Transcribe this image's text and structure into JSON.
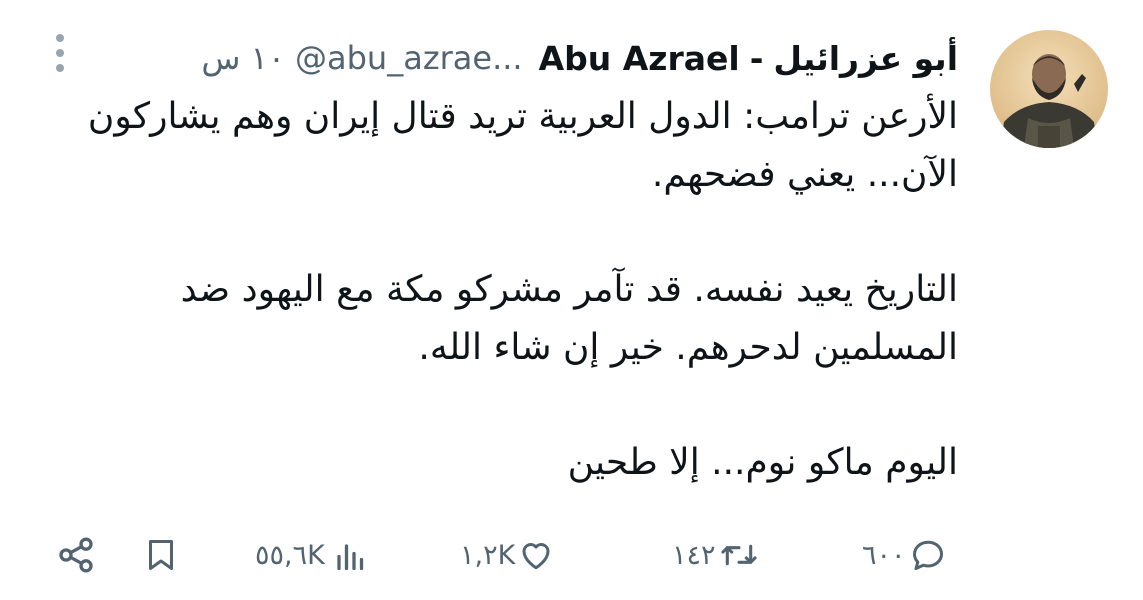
{
  "tweet": {
    "display_name_ar": "أبو عزرائيل",
    "separator": "-",
    "display_name_en": "Abu Azrael",
    "handle": "@abu_azrae...",
    "time": "١٠ س",
    "paragraphs": [
      "الأرعن ترامب: الدول العربية تريد قتال إيران وهم يشاركون الآن... يعني فضحهم.",
      "التاريخ يعيد نفسه. قد تآمر مشركو مكة مع اليهود ضد المسلمين لدحرهم. خير إن شاء الله.",
      "اليوم ماكو نوم... إلا طحين"
    ]
  },
  "actions": {
    "replies": "٦٠٠",
    "reposts": "١٤٢",
    "likes": "١,٢K",
    "views": "٥٥,٦K"
  },
  "colors": {
    "text": "#0f1419",
    "secondary": "#536471",
    "background": "#ffffff"
  },
  "icons": [
    "avatar",
    "more-vertical-icon",
    "reply-icon",
    "repost-icon",
    "like-icon",
    "views-icon",
    "bookmark-icon",
    "share-icon"
  ]
}
